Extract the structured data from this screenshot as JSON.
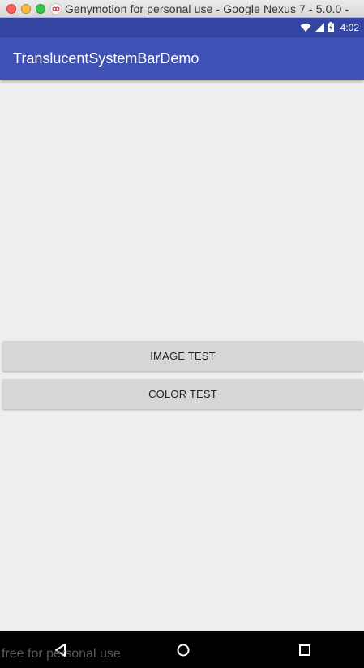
{
  "window": {
    "title": "Genymotion for personal use - Google Nexus 7 - 5.0.0 -"
  },
  "status_bar": {
    "time": "4:02",
    "icons": [
      "wifi-icon",
      "signal-icon",
      "battery-icon"
    ],
    "color": "#3345a0"
  },
  "app_bar": {
    "title": "TranslucentSystemBarDemo",
    "color": "#3f51b5"
  },
  "buttons": {
    "image_test": "IMAGE TEST",
    "color_test": "COLOR TEST"
  },
  "nav_bar": {
    "icons": [
      "back-icon",
      "home-icon",
      "recents-icon"
    ]
  },
  "watermark": "free for personal use"
}
